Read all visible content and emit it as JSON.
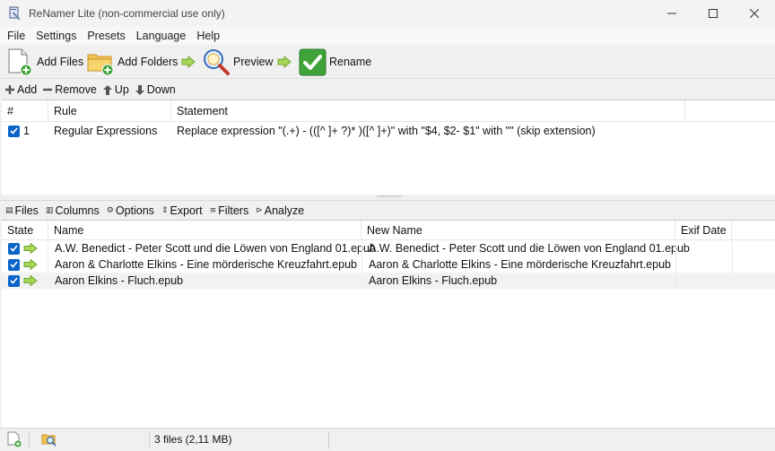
{
  "window": {
    "title": "ReNamer Lite (non-commercial use only)",
    "minimize_glyph": "—",
    "maximize_glyph": "☐",
    "close_glyph": "✕"
  },
  "menu": [
    "File",
    "Settings",
    "Presets",
    "Language",
    "Help"
  ],
  "toolbar": {
    "add_files": "Add Files",
    "add_folders": "Add Folders",
    "preview": "Preview",
    "rename": "Rename"
  },
  "rules_bar": {
    "add": "Add",
    "remove": "Remove",
    "up": "Up",
    "down": "Down"
  },
  "rules_table": {
    "headers": [
      "#",
      "Rule",
      "Statement"
    ],
    "rows": [
      {
        "checked": true,
        "num": "1",
        "rule": "Regular Expressions",
        "statement": "Replace expression \"(.+) - (([^ ]+ ?)* )([^ ]+)\" with \"$4, $2- $1\" with \"\" (skip extension)"
      }
    ]
  },
  "files_bar": {
    "files": "Files",
    "columns": "Columns",
    "options": "Options",
    "export": "Export",
    "filters": "Filters",
    "analyze": "Analyze"
  },
  "files_table": {
    "headers": [
      "State",
      "Name",
      "New Name",
      "Exif Date"
    ],
    "rows": [
      {
        "checked": true,
        "name": "A.W. Benedict - Peter Scott und die Löwen von England 01.epub",
        "new_name": "A.W. Benedict - Peter Scott und die Löwen von England 01.epub",
        "exif_date": ""
      },
      {
        "checked": true,
        "name": "Aaron & Charlotte Elkins - Eine mörderische Kreuzfahrt.epub",
        "new_name": "Aaron & Charlotte Elkins - Eine mörderische Kreuzfahrt.epub",
        "exif_date": ""
      },
      {
        "checked": true,
        "name": "Aaron Elkins - Fluch.epub",
        "new_name": "Aaron Elkins - Fluch.epub",
        "exif_date": ""
      }
    ]
  },
  "status": {
    "file_count": "3 files (2,11 MB)"
  },
  "colors": {
    "checkbox": "#0a64c8",
    "arrow_green": "#7fc73a",
    "rename_green": "#3fa33a",
    "selected_row": "#f2f2f2"
  }
}
